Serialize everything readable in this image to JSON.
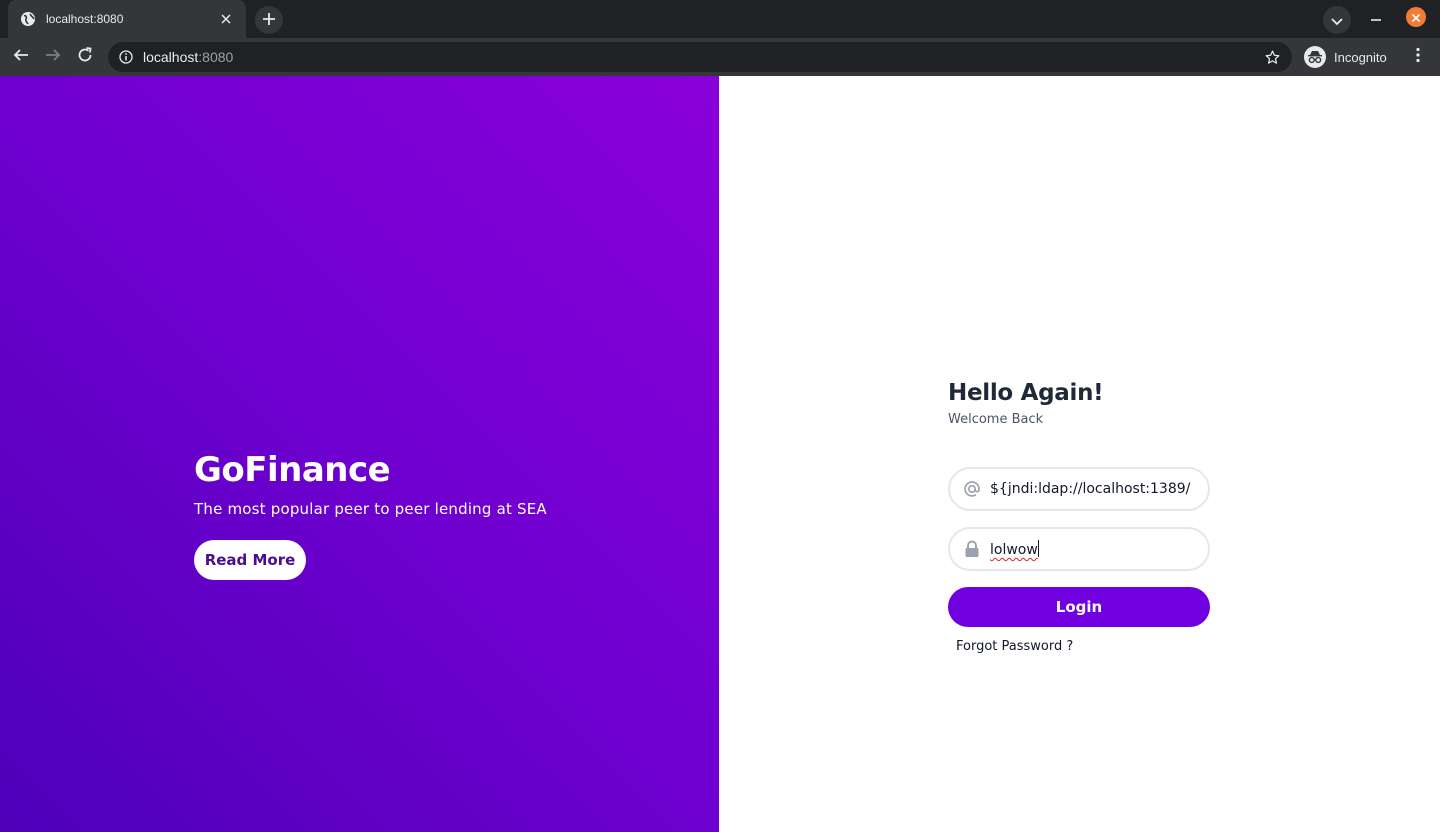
{
  "browser": {
    "tab_title": "localhost:8080",
    "url_host": "localhost",
    "url_port": ":8080",
    "profile_label": "Incognito",
    "icons": [
      "globe-icon",
      "close-icon",
      "plus-icon",
      "chevron-down-icon",
      "minimize-icon",
      "back-icon",
      "forward-icon",
      "reload-icon",
      "info-icon",
      "star-icon",
      "incognito-icon",
      "kebab-menu-icon"
    ],
    "colors": {
      "tabbar": "#202124",
      "toolbar": "#35363a",
      "close_button": "#f47b38"
    }
  },
  "hero": {
    "title": "GoFinance",
    "subtitle": "The most popular peer to peer lending at SEA",
    "read_more_label": "Read More",
    "gradient": [
      "#4e00b8",
      "#8a00d9"
    ]
  },
  "login": {
    "title": "Hello Again!",
    "subtitle": "Welcome Back",
    "email_value": "${jndi:ldap://localhost:1389/",
    "password_value": "lolwow",
    "login_label": "Login",
    "forgot_label": "Forgot Password ?",
    "accent_color": "#7100e1",
    "icons": [
      "at-sign-icon",
      "lock-icon"
    ]
  }
}
